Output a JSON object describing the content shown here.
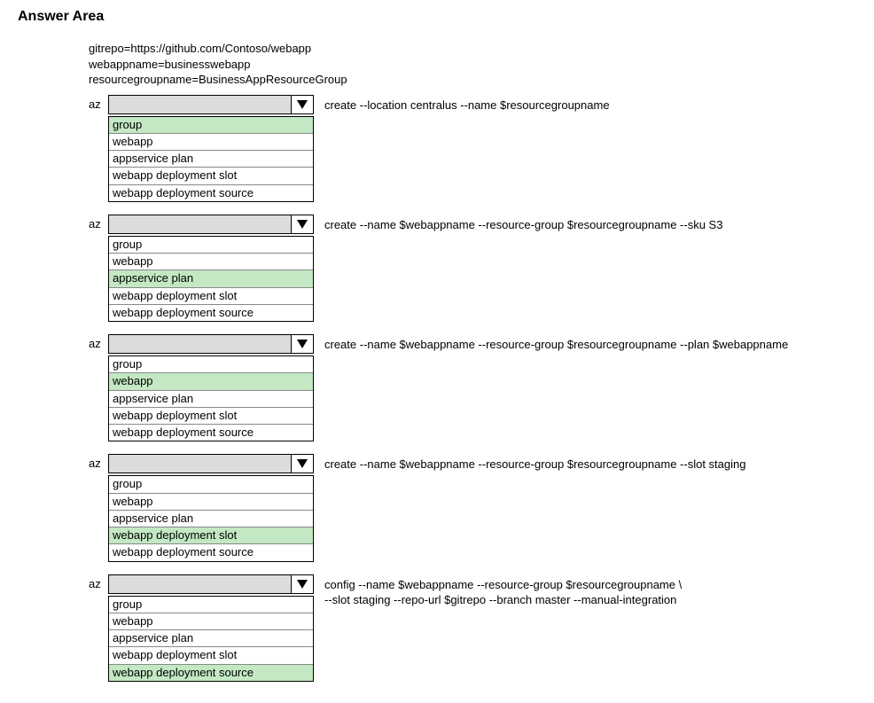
{
  "title": "Answer Area",
  "variables": [
    "gitrepo=https://github.com/Contoso/webapp",
    "webappname=businesswebapp",
    "resourcegroupname=BusinessAppResourceGroup"
  ],
  "options": [
    "group",
    "webapp",
    "appservice plan",
    "webapp deployment slot",
    "webapp deployment source"
  ],
  "commands": [
    {
      "az": "az",
      "selected_index": 0,
      "suffix": "create --location centralus --name $resourcegroupname"
    },
    {
      "az": "az",
      "selected_index": 2,
      "suffix": "create --name $webappname --resource-group $resourcegroupname --sku S3"
    },
    {
      "az": "az",
      "selected_index": 1,
      "suffix": "create --name $webappname --resource-group $resourcegroupname --plan $webappname"
    },
    {
      "az": "az",
      "selected_index": 3,
      "suffix": "create --name $webappname --resource-group $resourcegroupname --slot staging"
    },
    {
      "az": "az",
      "selected_index": 4,
      "suffix": "config --name $webappname --resource-group $resourcegroupname \\\n--slot staging --repo-url $gitrepo --branch master --manual-integration"
    }
  ]
}
